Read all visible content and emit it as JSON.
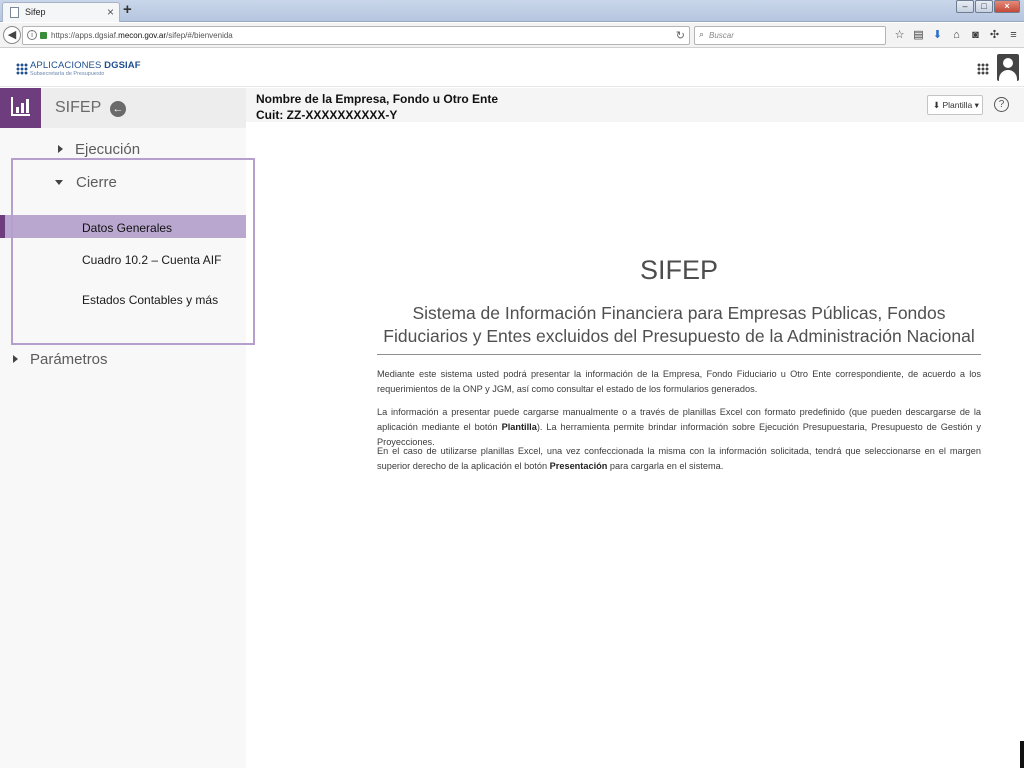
{
  "browser": {
    "tab_title": "Sifep",
    "url_scheme_host_prefix": "https://apps.dgsiaf.",
    "url_domain": "mecon.gov.ar",
    "url_path": "/sifep/#/bienvenida",
    "search_placeholder": "Buscar"
  },
  "header": {
    "logo_main": "APLICACIONES",
    "logo_brand": "DGSIAF",
    "logo_sub": "Subsecretaría de Presupuesto"
  },
  "sidebar": {
    "title": "SIFEP",
    "menu": [
      {
        "label": "Ejecución"
      },
      {
        "label": "Cierre"
      },
      {
        "label": "Parámetros"
      }
    ],
    "cierre_items": [
      {
        "label": "Datos Generales"
      },
      {
        "label": "Cuadro 10.2  – Cuenta AIF"
      },
      {
        "label": "Estados Contables y más"
      }
    ]
  },
  "content_header": {
    "entity_name": "Nombre de la Empresa, Fondo u Otro Ente",
    "entity_cuit": "Cuit: ZZ-XXXXXXXXXX-Y",
    "plantilla_label": "Plantilla"
  },
  "main": {
    "title": "SIFEP",
    "subtitle": "Sistema de Información Financiera para Empresas Públicas, Fondos Fiduciarios y Entes excluidos del Presupuesto de la Administración Nacional",
    "p1": "Mediante este sistema usted podrá presentar la información de la Empresa, Fondo Fiduciario u Otro Ente correspondiente, de acuerdo a los requerimientos de la ONP y JGM, así como consultar el estado de los formularios generados.",
    "p2_a": "La información a presentar puede cargarse manualmente o a través de planillas Excel con formato predefinido (que pueden descargarse de la aplicación mediante el botón ",
    "p2_bold": "Plantilla",
    "p2_b": "). La herramienta permite brindar información sobre Ejecución Presupuestaria, Presupuesto de Gestión y Proyecciones.",
    "p3_a": "En el caso de utilizarse planillas Excel, una vez confeccionada la misma con la información solicitada, tendrá que seleccionarse en el margen superior derecho de la aplicación el botón ",
    "p3_bold": "Presentación",
    "p3_b": " para cargarla en el sistema."
  },
  "colors": {
    "accent_purple": "#6e3d7e",
    "active_row": "#b9a7cf",
    "highlight_frame": "#b59fcc"
  }
}
